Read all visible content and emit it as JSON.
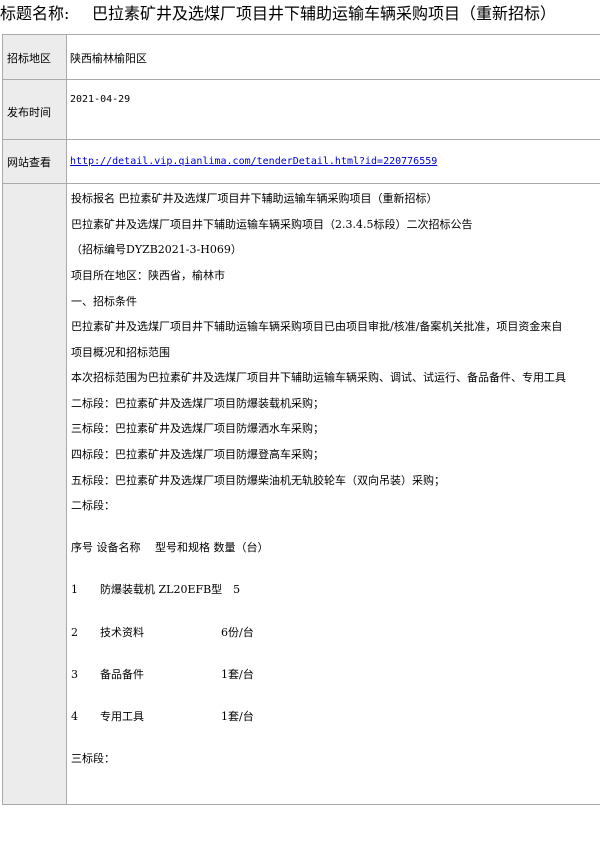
{
  "title": {
    "label": "标题名称:",
    "text": "巴拉素矿井及选煤厂项目井下辅助运输车辆采购项目（重新招标）"
  },
  "rows": {
    "area": {
      "key": "招标地区",
      "value": "陕西榆林榆阳区"
    },
    "time": {
      "key": "发布时间",
      "value": "2021-04-29"
    },
    "web": {
      "key": "网站查看",
      "value": "http://detail.vip.qianlima.com/tenderDetail.html?id=220776559"
    }
  },
  "content": {
    "lines": [
      "投标报名 巴拉素矿井及选煤厂项目井下辅助运输车辆采购项目（重新招标）",
      "巴拉素矿井及选煤厂项目井下辅助运输车辆采购项目（2.3.4.5标段）二次招标公告",
      "（招标编号DYZB2021-3-H069）",
      "项目所在地区：陕西省，榆林市",
      "一、招标条件",
      "巴拉素矿井及选煤厂项目井下辅助运输车辆采购项目已由项目审批/核准/备案机关批准，项目资金来自",
      "项目概况和招标范围",
      "本次招标范围为巴拉素矿井及选煤厂项目井下辅助运输车辆采购、调试、试运行、备品备件、专用工具",
      "二标段：巴拉素矿井及选煤厂项目防爆装载机采购；",
      "三标段：巴拉素矿井及选煤厂项目防爆洒水车采购；",
      "四标段：巴拉素矿井及选煤厂项目防爆登高车采购；",
      "五标段：巴拉素矿井及选煤厂项目防爆柴油机无轨胶轮车（双向吊装）采购；",
      "二标段：",
      "序号 设备名称　 型号和规格 数量（台）",
      "1　　防爆装载机 ZL20EFB型　5",
      "2　　技术资料　　　　　　　6份/台",
      "3　　备品备件　　　　　　　1套/台",
      "4　　专用工具　　　　　　　1套/台",
      "三标段："
    ]
  }
}
